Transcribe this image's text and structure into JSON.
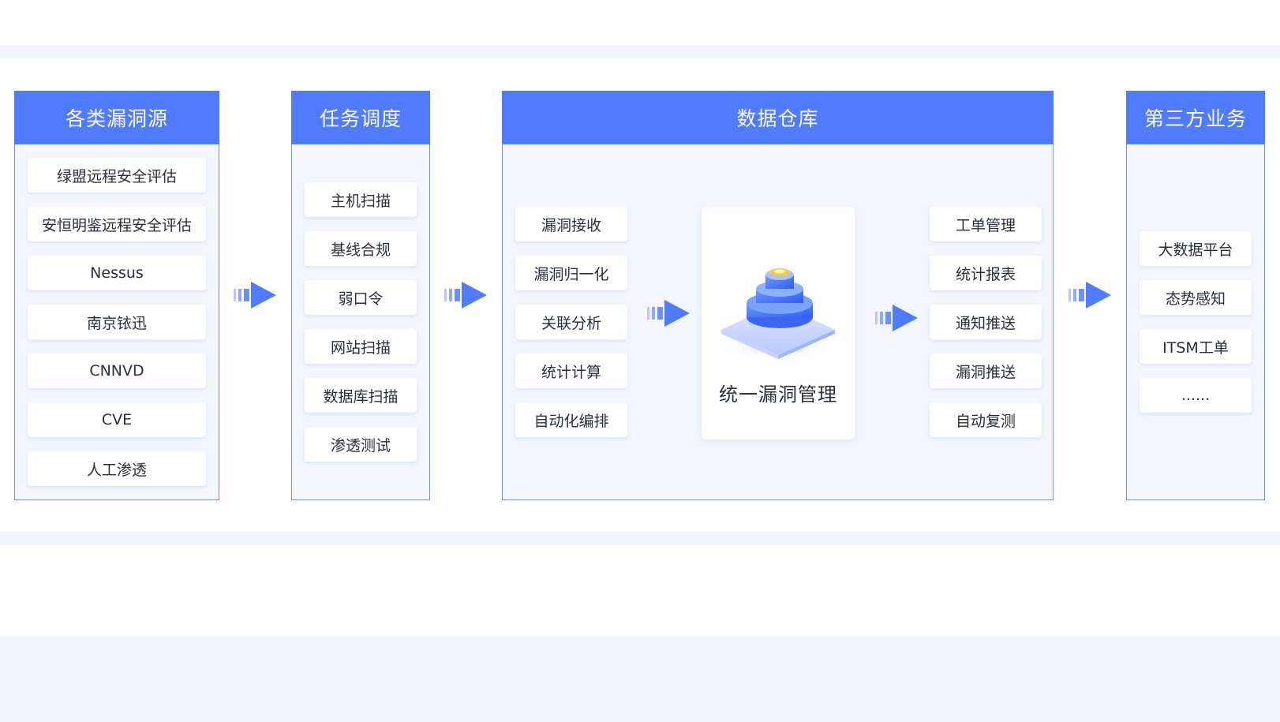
{
  "colors": {
    "accent": "#4f7bfc",
    "panel_bg": "#f3f6fd",
    "band": "#f2f5fb"
  },
  "sources": {
    "title": "各类漏洞源",
    "items": [
      "绿盟远程安全评估",
      "安恒明鉴远程安全评估",
      "Nessus",
      "南京铱迅",
      "CNNVD",
      "CVE",
      "人工渗透"
    ]
  },
  "scheduling": {
    "title": "任务调度",
    "items": [
      "主机扫描",
      "基线合规",
      "弱口令",
      "网站扫描",
      "数据库扫描",
      "渗透测试"
    ]
  },
  "warehouse": {
    "title": "数据仓库",
    "left_items": [
      "漏洞接收",
      "漏洞归一化",
      "关联分析",
      "统计计算",
      "自动化编排"
    ],
    "core_label": "统一漏洞管理",
    "core_icon": "layered-gear-icon",
    "right_items": [
      "工单管理",
      "统计报表",
      "通知推送",
      "漏洞推送",
      "自动复测"
    ]
  },
  "third_party": {
    "title": "第三方业务",
    "items": [
      "大数据平台",
      "态势感知",
      "ITSM工单",
      "......"
    ]
  },
  "flow_arrow_icon": "flow-arrow-icon"
}
